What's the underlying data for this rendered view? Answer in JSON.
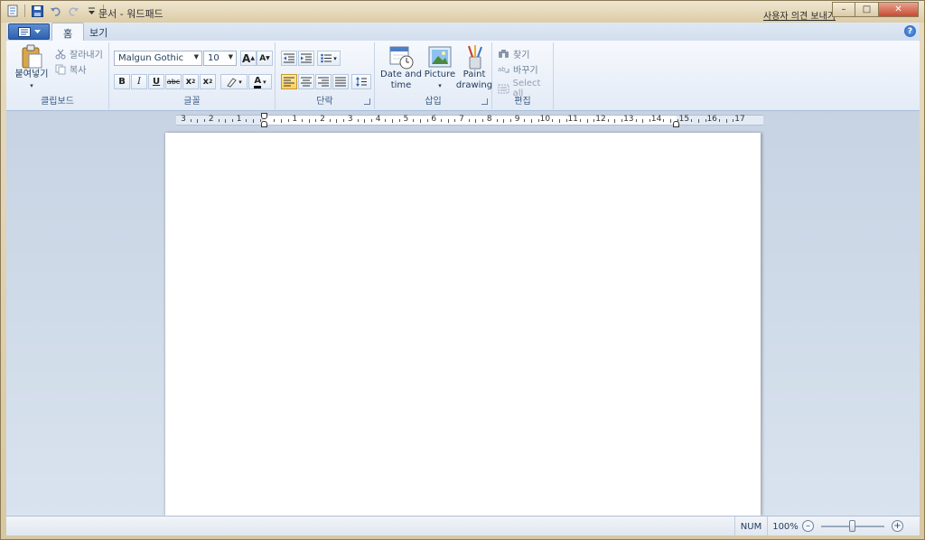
{
  "window": {
    "title": "문서 - 워드패드",
    "feedback_link": "사용자 의견 보내기",
    "minimize": "–",
    "maximize": "□",
    "close": "✕"
  },
  "tabs": [
    {
      "label": "홈",
      "active": true
    },
    {
      "label": "보기",
      "active": false
    }
  ],
  "ribbon": {
    "clipboard": {
      "group_label": "클립보드",
      "paste": "붙여넣기",
      "cut": "잘라내기",
      "copy": "복사"
    },
    "font": {
      "group_label": "글꼴",
      "font_name": "Malgun Gothic",
      "font_size": "10",
      "grow": "A",
      "shrink": "A",
      "bold": "B",
      "italic": "I",
      "underline": "U",
      "strike": "abc",
      "subscript": "x",
      "superscript": "x",
      "highlight_icon": "highlighter-icon",
      "color_label": "A"
    },
    "paragraph": {
      "group_label": "단락"
    },
    "insert": {
      "group_label": "삽입",
      "date_time_line1": "Date and",
      "date_time_line2": "time",
      "picture": "Picture",
      "paint_line1": "Paint",
      "paint_line2": "drawing"
    },
    "editing": {
      "group_label": "편집",
      "find": "찾기",
      "replace": "바꾸기",
      "select_all": "Select all"
    }
  },
  "ruler": {
    "labels": [
      "3",
      "2",
      "1",
      "",
      "1",
      "2",
      "3",
      "4",
      "5",
      "6",
      "7",
      "8",
      "9",
      "10",
      "11",
      "12",
      "13",
      "14",
      "15",
      "16",
      "17"
    ]
  },
  "status": {
    "num": "NUM",
    "zoom": "100%",
    "zoom_level_percent": 100
  },
  "colors": {
    "accent_blue": "#1e395b",
    "ribbon_bg": "#e3ebf6",
    "active_align": "#ffd061"
  }
}
